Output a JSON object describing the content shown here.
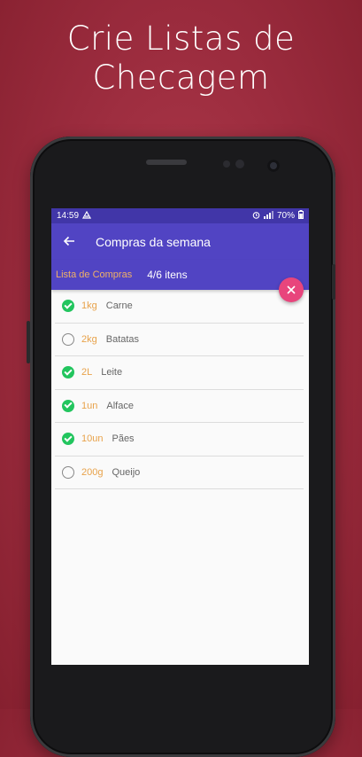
{
  "headline": {
    "line1": "Crie Listas de",
    "line2": "Checagem"
  },
  "statusbar": {
    "time": "14:59",
    "battery": "70%"
  },
  "appbar": {
    "title": "Compras da semana"
  },
  "subbar": {
    "list_name": "Lista de Compras",
    "count": "4/6 itens"
  },
  "items": [
    {
      "qty": "1kg",
      "name": "Carne",
      "checked": true
    },
    {
      "qty": "2kg",
      "name": "Batatas",
      "checked": false
    },
    {
      "qty": "2L",
      "name": "Leite",
      "checked": true
    },
    {
      "qty": "1un",
      "name": "Alface",
      "checked": true
    },
    {
      "qty": "10un",
      "name": "Pães",
      "checked": true
    },
    {
      "qty": "200g",
      "name": "Queijo",
      "checked": false
    }
  ],
  "colors": {
    "background": "#9a2b3d",
    "primary": "#5144c3",
    "status_bar": "#4136a8",
    "accent_orange": "#e8a24a",
    "fab": "#e8457c",
    "check_green": "#22c55e"
  },
  "icons": {
    "back": "arrow-left-icon",
    "close": "close-icon",
    "checked": "check-circle-icon",
    "unchecked": "empty-circle-icon"
  }
}
